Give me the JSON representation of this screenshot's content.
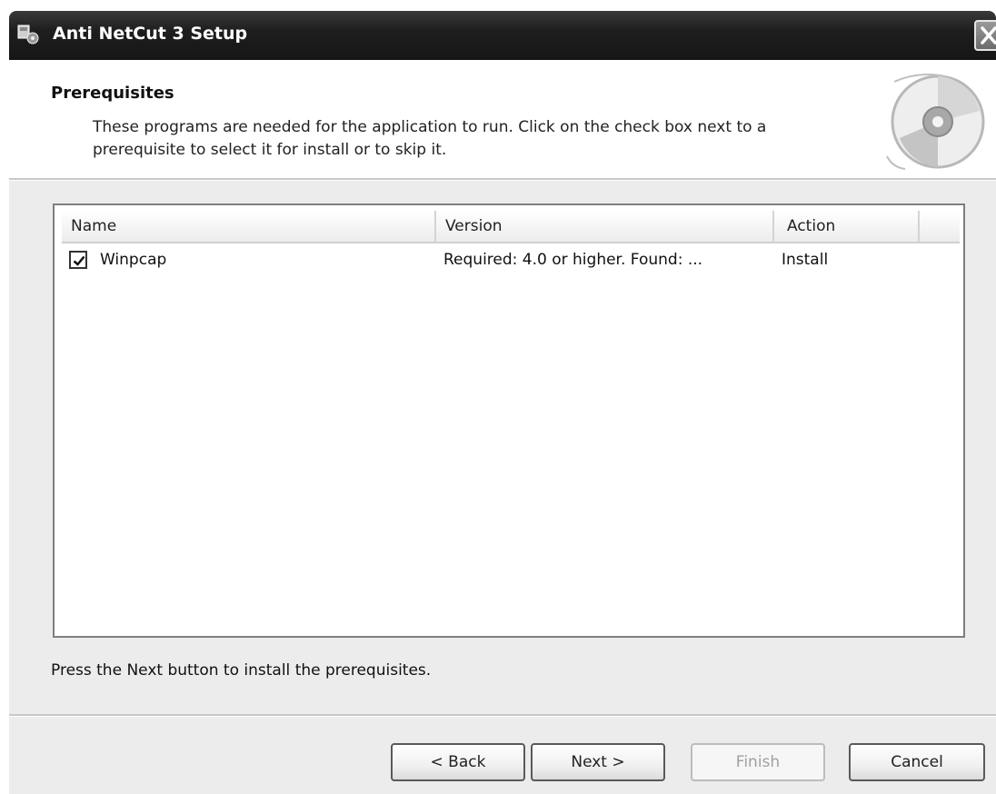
{
  "window": {
    "title": "Anti NetCut 3 Setup"
  },
  "header": {
    "heading": "Prerequisites",
    "description": "These programs are needed for the application to run. Click on the check box next to a prerequisite to select it for install or to skip it."
  },
  "prereq_list": {
    "columns": [
      "Name",
      "Version",
      "Action"
    ],
    "rows": [
      {
        "checked": true,
        "name": "Winpcap",
        "version": "Required: 4.0 or higher. Found: ...",
        "action": "Install"
      }
    ]
  },
  "footer": {
    "instruction": "Press the Next button to install the prerequisites."
  },
  "buttons": {
    "back": "< Back",
    "next": "Next >",
    "finish": "Finish",
    "cancel": "Cancel"
  }
}
